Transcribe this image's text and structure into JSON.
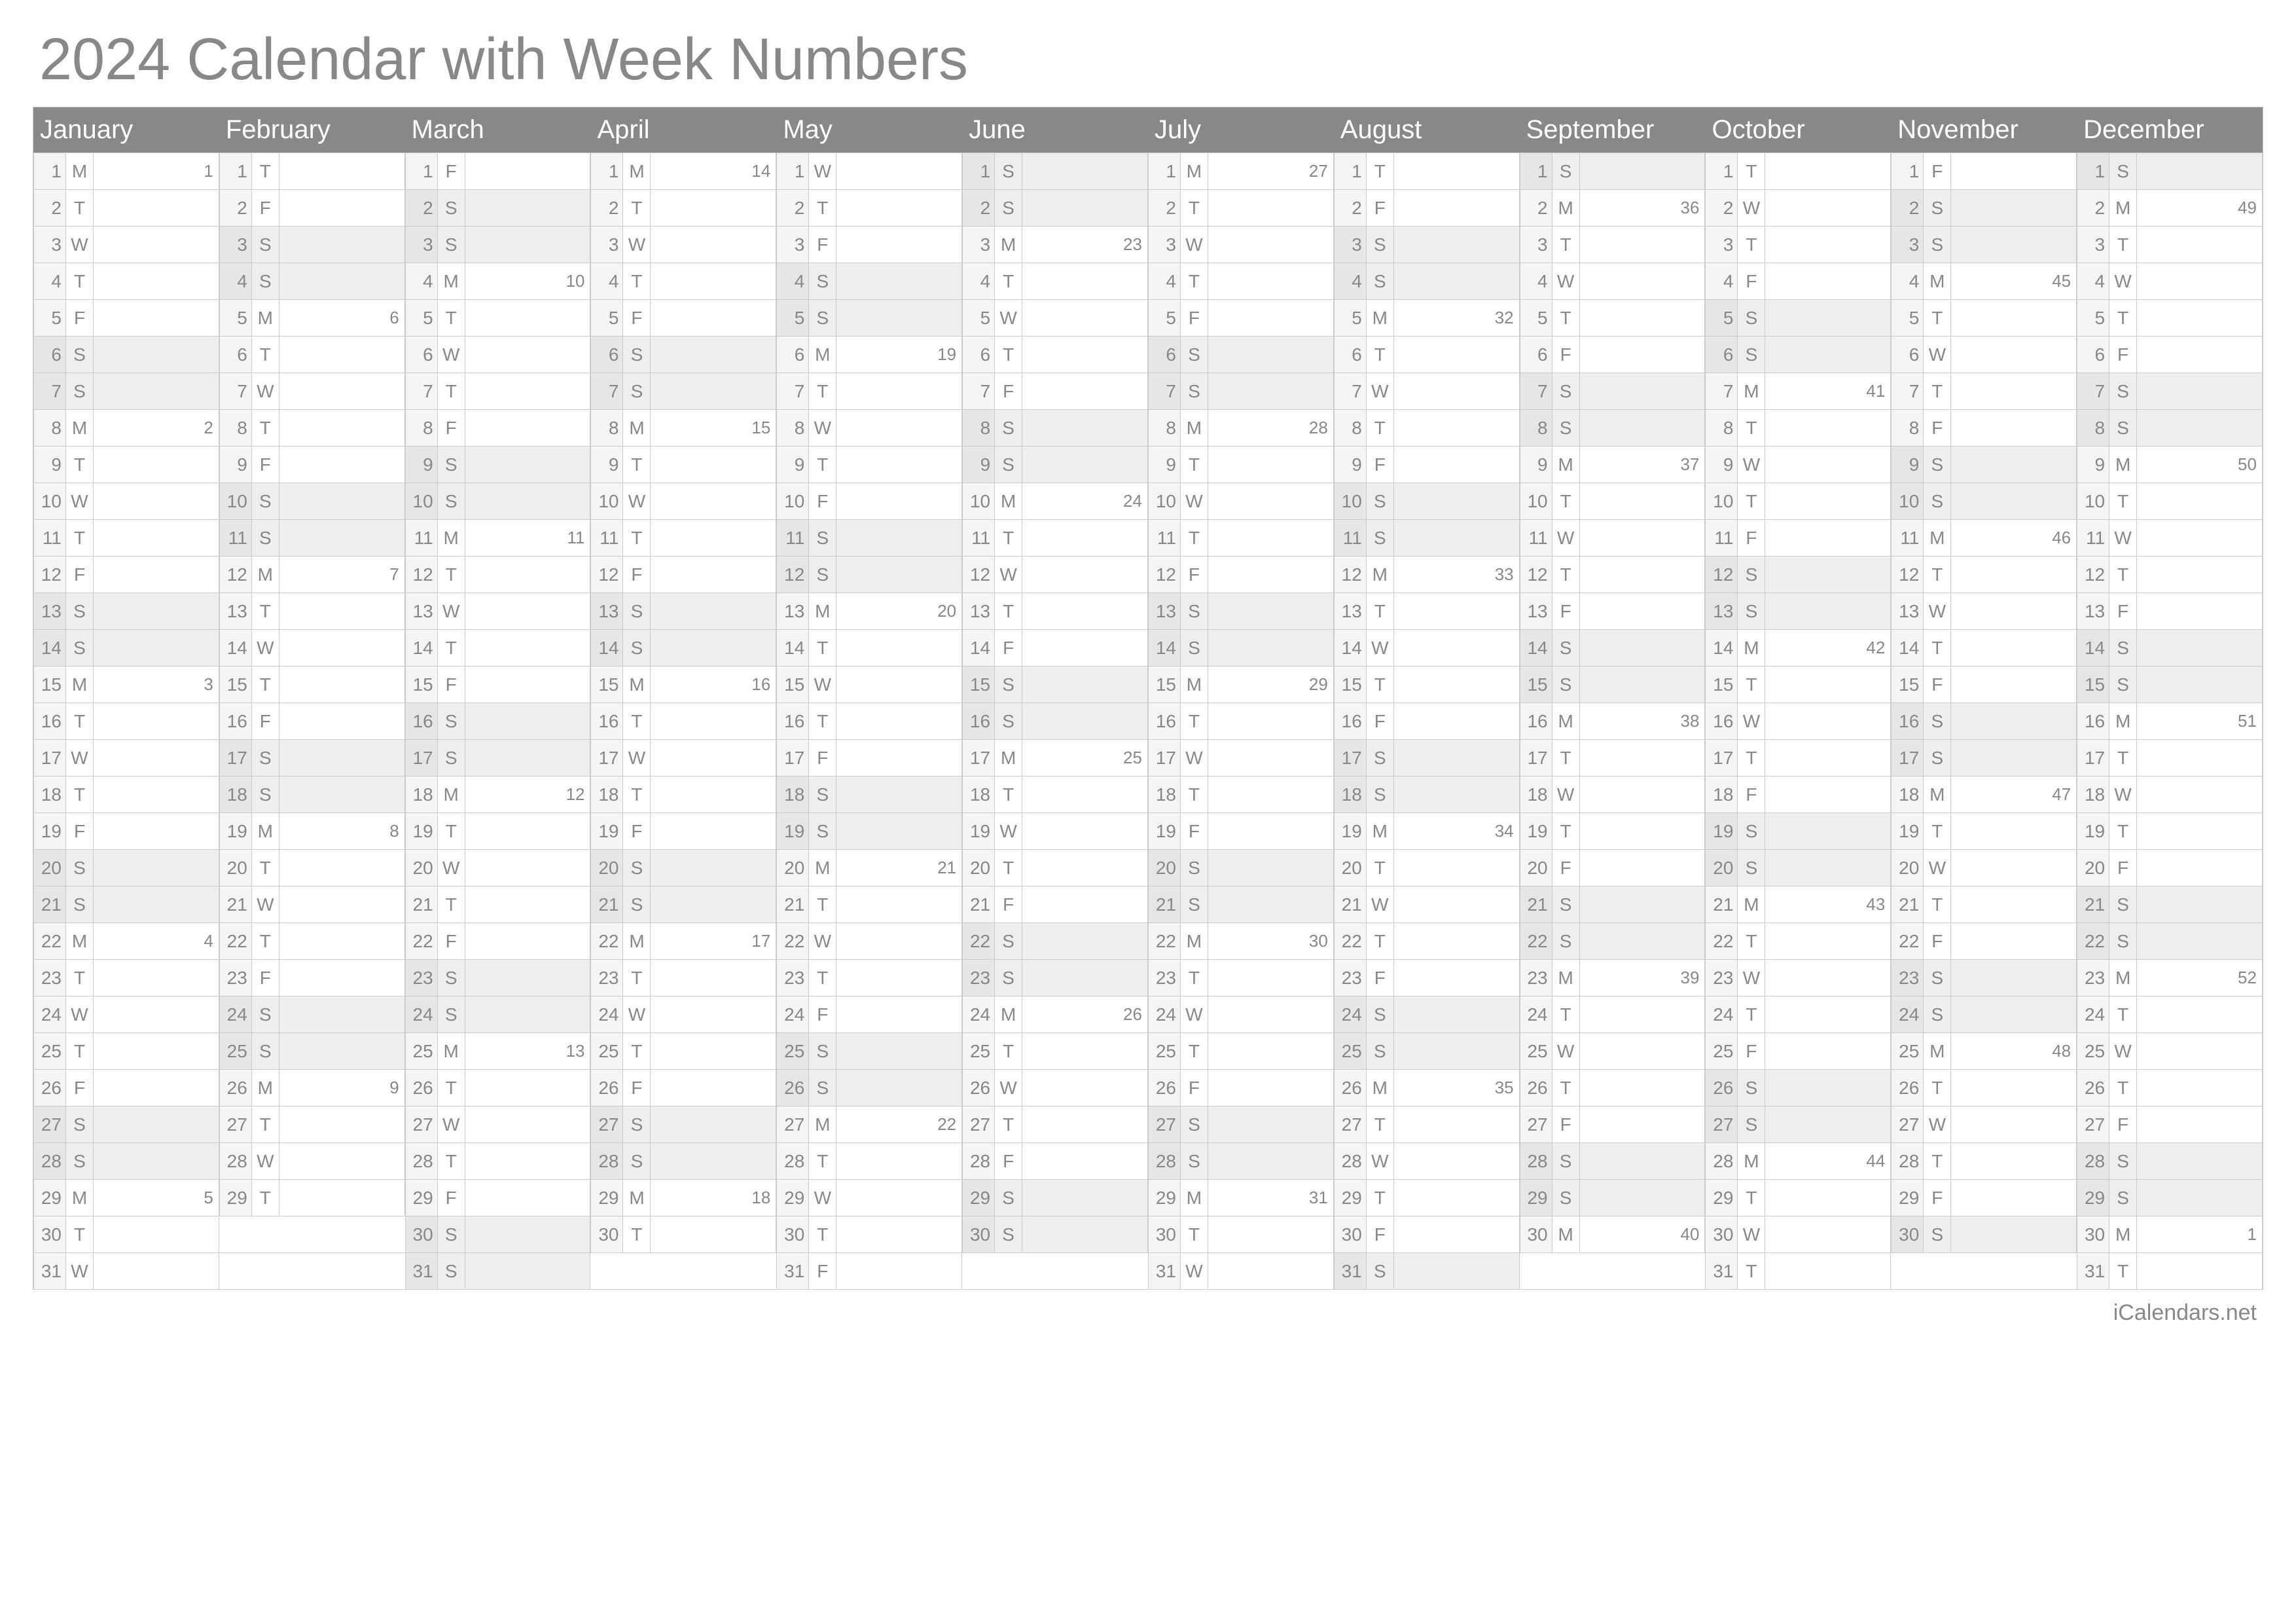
{
  "title": "2024 Calendar with Week Numbers",
  "footer": "iCalendars.net",
  "year": 2024,
  "dow_letters": [
    "M",
    "T",
    "W",
    "T",
    "F",
    "S",
    "S"
  ],
  "first_weekday": [
    0,
    3,
    4,
    0,
    2,
    5,
    0,
    3,
    6,
    1,
    4,
    6
  ],
  "days_in_month": [
    31,
    29,
    31,
    30,
    31,
    30,
    31,
    31,
    30,
    31,
    30,
    31
  ],
  "months": [
    "January",
    "February",
    "March",
    "April",
    "May",
    "June",
    "July",
    "August",
    "September",
    "October",
    "November",
    "December"
  ],
  "week_numbers": {
    "January": {
      "1": 1,
      "8": 2,
      "15": 3,
      "22": 4,
      "29": 5
    },
    "February": {
      "5": 6,
      "12": 7,
      "19": 8,
      "26": 9
    },
    "March": {
      "4": 10,
      "11": 11,
      "18": 12,
      "25": 13
    },
    "April": {
      "1": 14,
      "8": 15,
      "15": 16,
      "22": 17,
      "29": 18
    },
    "May": {
      "6": 19,
      "13": 20,
      "20": 21,
      "27": 22
    },
    "June": {
      "3": 23,
      "10": 24,
      "17": 25,
      "24": 26
    },
    "July": {
      "1": 27,
      "8": 28,
      "15": 29,
      "22": 30,
      "29": 31
    },
    "August": {
      "5": 32,
      "12": 33,
      "19": 34,
      "26": 35
    },
    "September": {
      "2": 36,
      "9": 37,
      "16": 38,
      "23": 39,
      "30": 40
    },
    "October": {
      "7": 41,
      "14": 42,
      "21": 43,
      "28": 44
    },
    "November": {
      "4": 45,
      "11": 46,
      "18": 47,
      "25": 48
    },
    "December": {
      "2": 49,
      "9": 50,
      "16": 51,
      "23": 52,
      "30": 1
    }
  }
}
